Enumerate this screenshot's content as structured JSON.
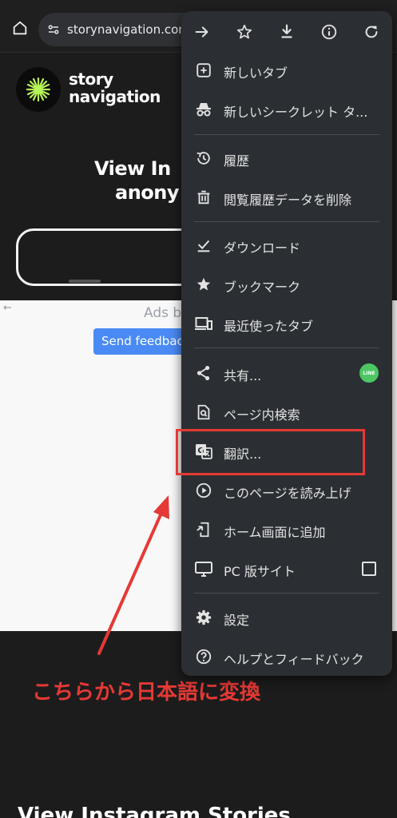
{
  "browser": {
    "url": "storynavigation.com"
  },
  "page": {
    "logo_text_line1": "story",
    "logo_text_line2": "navigation",
    "hero_line1": "View In",
    "hero_line2": "anony",
    "ads_by": "Ads b",
    "ad_back": "←",
    "feedback_button": "Send feedback",
    "bottom_heading": "View Instagram Stories"
  },
  "menu": {
    "toolbar": [
      {
        "icon": "forward-arrow-icon"
      },
      {
        "icon": "bookmark-star-icon"
      },
      {
        "icon": "download-icon"
      },
      {
        "icon": "page-info-icon"
      },
      {
        "icon": "reload-icon"
      }
    ],
    "items": [
      {
        "label": "新しいタブ",
        "icon": "new-tab-icon"
      },
      {
        "label": "新しいシークレット タ...",
        "icon": "incognito-icon"
      },
      {
        "label": "履歴",
        "icon": "history-icon"
      },
      {
        "label": "閲覧履歴データを削除",
        "icon": "trash-icon"
      },
      {
        "label": "ダウンロード",
        "icon": "downloads-icon"
      },
      {
        "label": "ブックマーク",
        "icon": "star-icon"
      },
      {
        "label": "最近使ったタブ",
        "icon": "recent-tabs-icon"
      },
      {
        "label": "共有...",
        "icon": "share-icon"
      },
      {
        "label": "ページ内検索",
        "icon": "find-in-page-icon"
      },
      {
        "label": "翻訳...",
        "icon": "translate-icon"
      },
      {
        "label": "このページを読み上げ",
        "icon": "play-circle-icon"
      },
      {
        "label": "ホーム画面に追加",
        "icon": "add-to-home-icon"
      },
      {
        "label": "PC 版サイト",
        "icon": "desktop-icon"
      },
      {
        "label": "設定",
        "icon": "settings-gear-icon"
      },
      {
        "label": "ヘルプとフィードバック",
        "icon": "help-icon"
      }
    ],
    "line_badge": "LINE"
  },
  "annotation": {
    "text": "こちらから日本語に変換",
    "color": "#e53935"
  }
}
